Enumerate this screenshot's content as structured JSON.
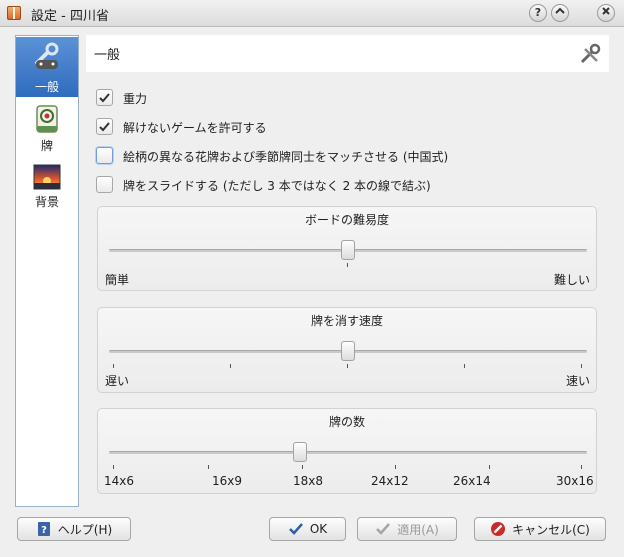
{
  "window": {
    "title": "設定 - 四川省",
    "help_btn": "?",
    "shade_btn": "^",
    "close_btn": "✕"
  },
  "sidebar": {
    "items": [
      {
        "label": "一般",
        "icon": "tools-gamepad-icon"
      },
      {
        "label": "牌",
        "icon": "mahjong-tile-icon"
      },
      {
        "label": "背景",
        "icon": "landscape-icon"
      }
    ]
  },
  "page": {
    "title": "一般",
    "icon": "tools-icon"
  },
  "options": [
    {
      "label": "重力",
      "checked": true
    },
    {
      "label": "解けないゲームを許可する",
      "checked": true
    },
    {
      "label": "絵柄の異なる花牌および季節牌同士をマッチさせる (中国式)",
      "checked": false
    },
    {
      "label": "牌をスライドする (ただし 3 本ではなく 2 本の線で結ぶ)",
      "checked": false
    }
  ],
  "difficulty": {
    "title": "ボードの難易度",
    "min_label": "簡単",
    "max_label": "難しい",
    "level": 0.5
  },
  "speed": {
    "title": "牌を消す速度",
    "min_label": "遅い",
    "max_label": "速い",
    "level": 0.5
  },
  "tiles": {
    "title": "牌の数",
    "ticks": [
      "14x6",
      "16x9",
      "18x8",
      "24x12",
      "26x14",
      "30x16"
    ],
    "selected": "18x8"
  },
  "buttons": {
    "help": "ヘルプ(H)",
    "ok": "OK",
    "apply": "適用(A)",
    "cancel": "キャンセル(C)"
  },
  "colors": {
    "accent": "#3a78c8",
    "window_bg": "#efefef"
  }
}
